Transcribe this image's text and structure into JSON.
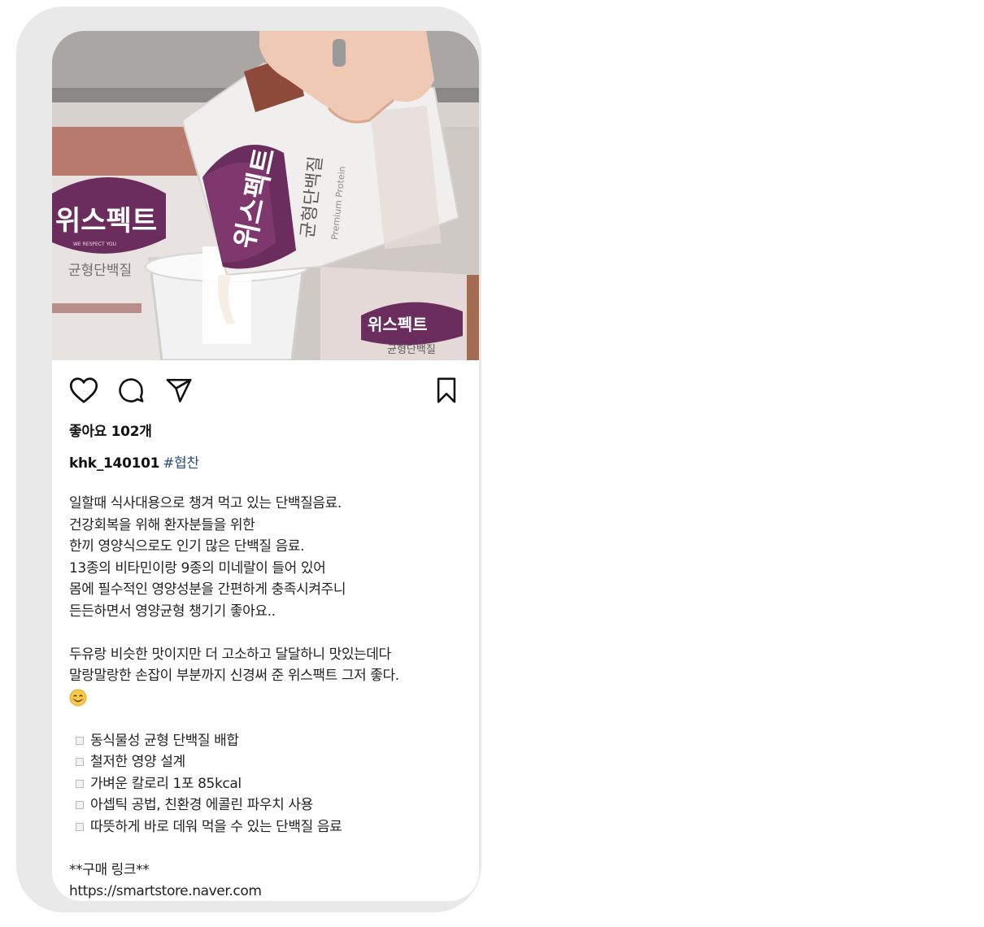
{
  "post": {
    "photo_alt": "위스펙트 균형단백질 pouch being poured into a glass",
    "pack_brand": "위스펙트",
    "pack_tagline": "WE RESPECT YOU",
    "pack_product": "균형단백질",
    "pack_product_en": "Premium Protein",
    "likes_text": "좋아요 102개",
    "username": "khk_140101",
    "hashtag": "#협찬",
    "caption_lines": [
      "일할때 식사대용으로 챙겨 먹고 있는 단백질음료.",
      "건강회복을 위해 환자분들을 위한",
      "한끼 영양식으로도 인기 많은 단백질 음료.",
      "13종의 비타민이랑 9종의 미네랄이 들어 있어",
      "몸에 필수적인 영양성분을 간편하게 충족시켜주니",
      "든든하면서 영양균형 챙기기 좋아요..",
      "",
      "두유랑 비슷한 맛이지만 더 고소하고 달달하니 맛있는데다",
      "말랑말랑한 손잡이 부분까지 신경써 준 위스팩트 그저 좋다."
    ],
    "bullets": [
      "동식물성 균형 단백질 배합",
      "철저한 영양 설계",
      "가벼운 칼로리 1포 85kcal",
      "아셉틱 공법, 친환경 에콜린 파우치 사용",
      "따뜻하게 바로 데워 먹을 수 있는 단백질 음료"
    ],
    "link_heading": "**구매 링크**",
    "link_url": "https://smartstore.naver.com"
  },
  "icons": {
    "like": "heart-outline-icon",
    "comment": "comment-bubble-icon",
    "share": "paper-plane-icon",
    "save": "bookmark-outline-icon",
    "emoji": "smiling-face-emoji"
  },
  "colors": {
    "frame": "#e9e9e9",
    "brand_purple": "#6b2d5e",
    "brand_brown": "#9a5a3e",
    "hashtag": "#2b4f77"
  }
}
